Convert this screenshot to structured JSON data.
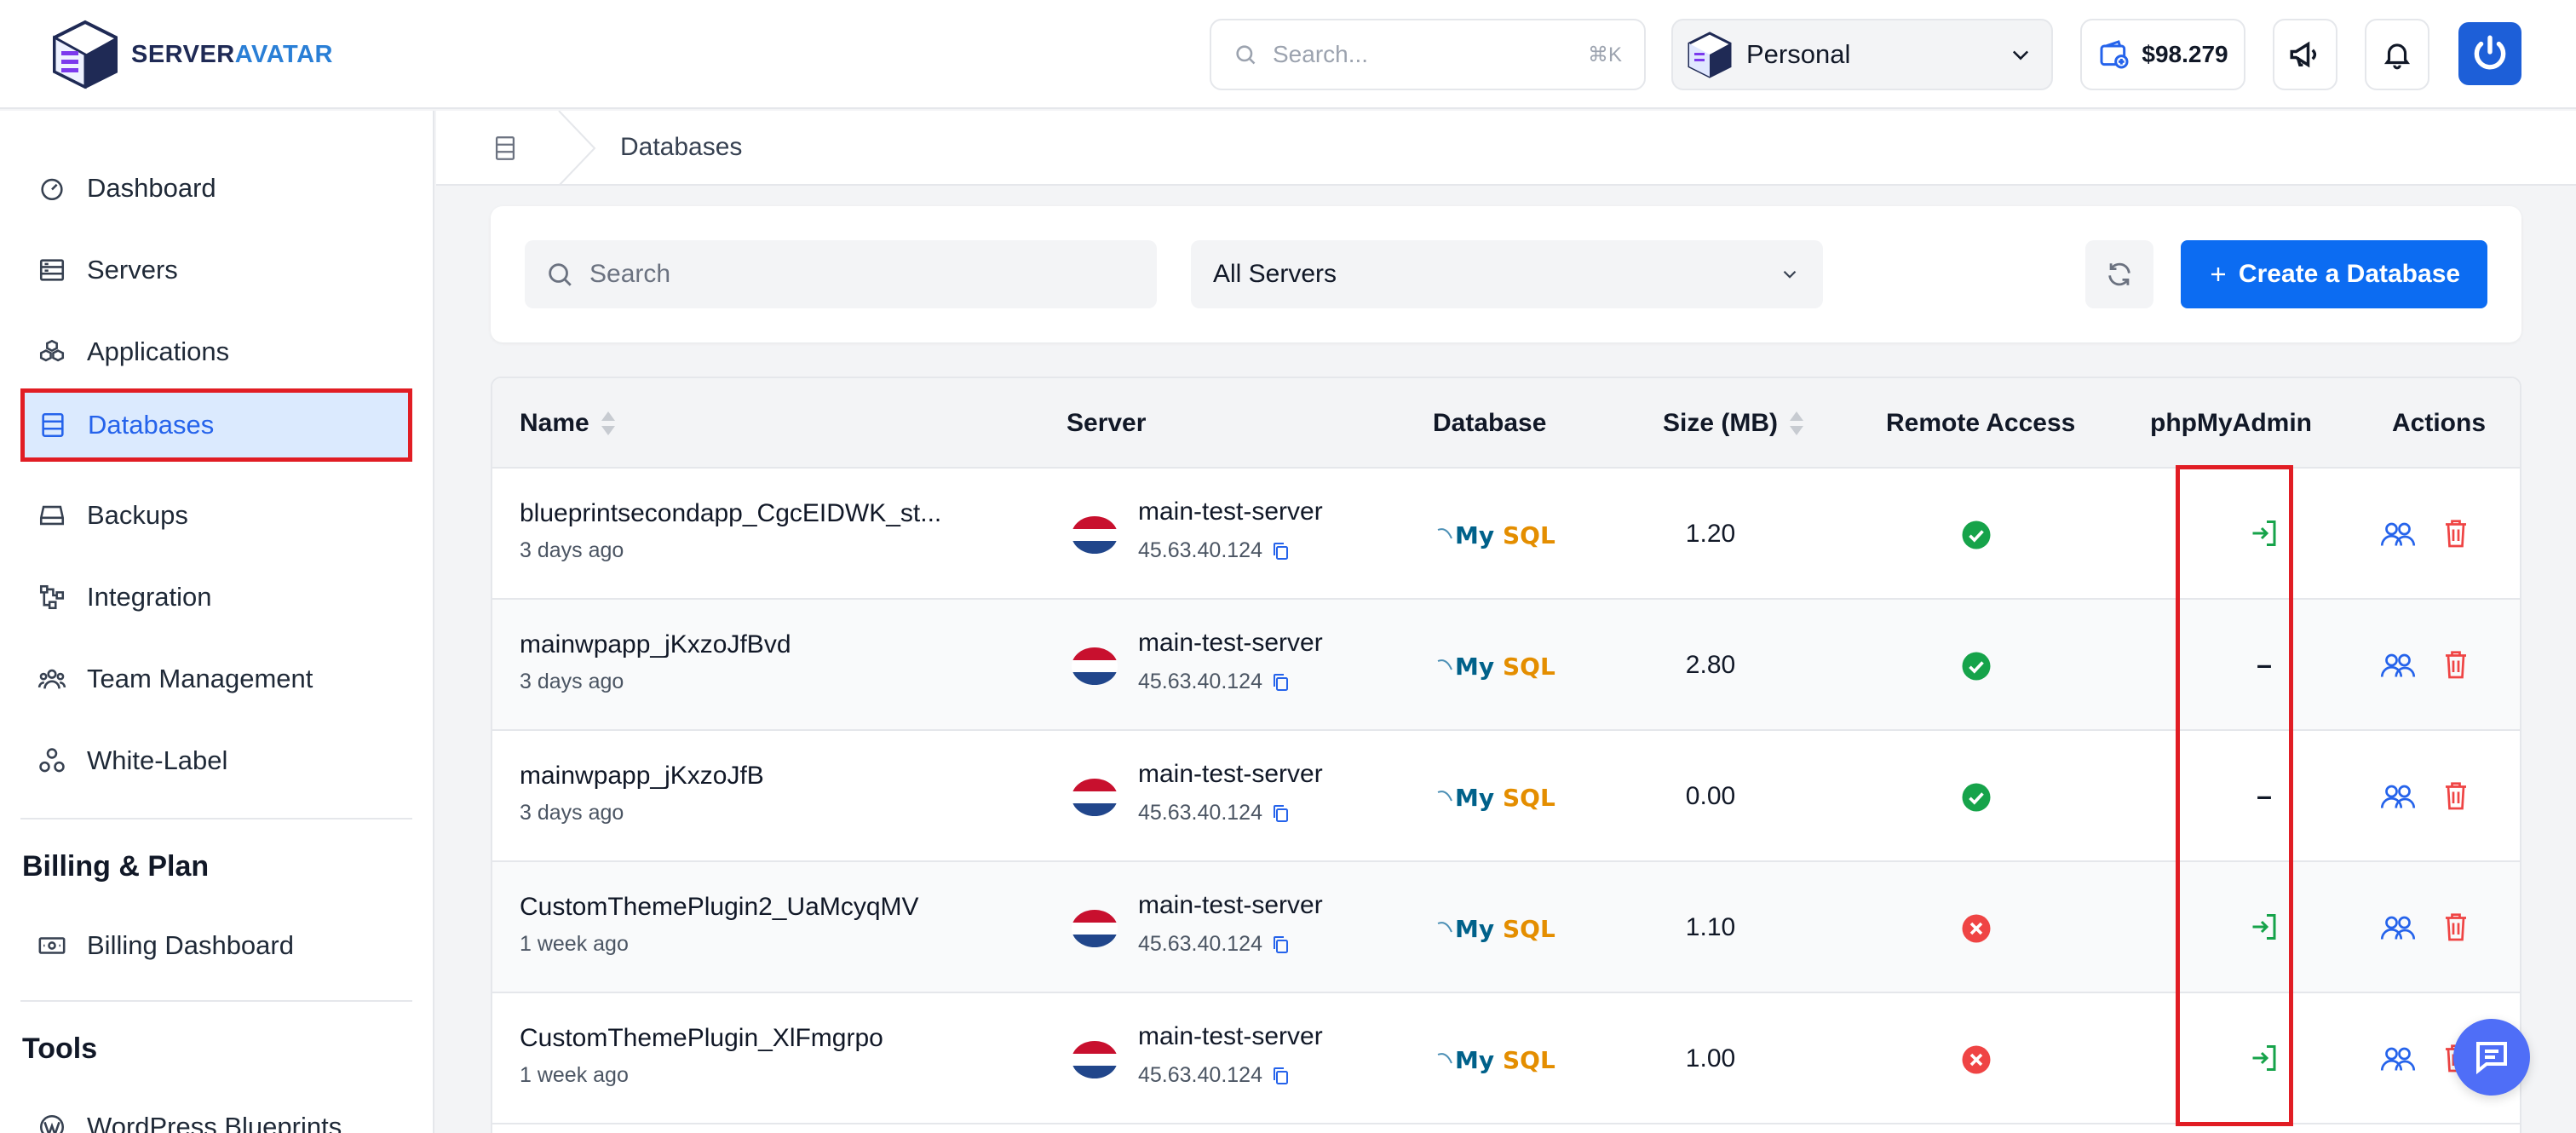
{
  "header": {
    "logo_part1": "SERVER",
    "logo_part2": "AVATAR",
    "search_placeholder": "Search...",
    "search_shortcut": "⌘K",
    "workspace": "Personal",
    "credit": "$98.279",
    "icons": {
      "announce": "megaphone-icon",
      "notify": "bell-icon",
      "power": "power-icon"
    }
  },
  "sidebar": {
    "items": [
      {
        "label": "Dashboard",
        "icon": "gauge-icon"
      },
      {
        "label": "Servers",
        "icon": "server-icon"
      },
      {
        "label": "Applications",
        "icon": "applications-icon"
      },
      {
        "label": "Databases",
        "icon": "database-icon",
        "active": true
      },
      {
        "label": "Backups",
        "icon": "backup-icon"
      },
      {
        "label": "Integration",
        "icon": "integration-icon"
      },
      {
        "label": "Team Management",
        "icon": "team-icon"
      },
      {
        "label": "White-Label",
        "icon": "white-label-icon"
      }
    ],
    "billing_title": "Billing & Plan",
    "billing_items": [
      {
        "label": "Billing Dashboard",
        "icon": "billing-icon"
      }
    ],
    "tools_title": "Tools",
    "tools_items": [
      {
        "label": "WordPress Blueprints",
        "icon": "wordpress-icon"
      }
    ]
  },
  "breadcrumb": {
    "current": "Databases"
  },
  "filters": {
    "search_placeholder": "Search",
    "server_select": "All Servers",
    "create_label": "Create a Database"
  },
  "table": {
    "headers": {
      "name": "Name",
      "server": "Server",
      "database": "Database",
      "size": "Size (MB)",
      "remote": "Remote Access",
      "pma": "phpMyAdmin",
      "actions": "Actions"
    },
    "engine_label": {
      "part1": "My",
      "part2": "SQL"
    },
    "rows": [
      {
        "name": "blueprintsecondapp_CgcEIDWK_st...",
        "time": "3 days ago",
        "server": "main-test-server",
        "ip": "45.63.40.124",
        "size": "1.20",
        "remote": true,
        "pma": "link",
        "pma_text": ""
      },
      {
        "name": "mainwpapp_jKxzoJfBvd",
        "time": "3 days ago",
        "server": "main-test-server",
        "ip": "45.63.40.124",
        "size": "2.80",
        "remote": true,
        "pma": "none",
        "pma_text": "–"
      },
      {
        "name": "mainwpapp_jKxzoJfB",
        "time": "3 days ago",
        "server": "main-test-server",
        "ip": "45.63.40.124",
        "size": "0.00",
        "remote": true,
        "pma": "none",
        "pma_text": "–"
      },
      {
        "name": "CustomThemePlugin2_UaMcyqMV",
        "time": "1 week ago",
        "server": "main-test-server",
        "ip": "45.63.40.124",
        "size": "1.10",
        "remote": false,
        "pma": "link",
        "pma_text": ""
      },
      {
        "name": "CustomThemePlugin_XlFmgrpo",
        "time": "1 week ago",
        "server": "main-test-server",
        "ip": "45.63.40.124",
        "size": "1.00",
        "remote": false,
        "pma": "link",
        "pma_text": ""
      }
    ]
  },
  "colors": {
    "primary": "#0c6cf2",
    "success": "#16a34a",
    "danger": "#ef4444",
    "highlight": "#e11d24"
  }
}
